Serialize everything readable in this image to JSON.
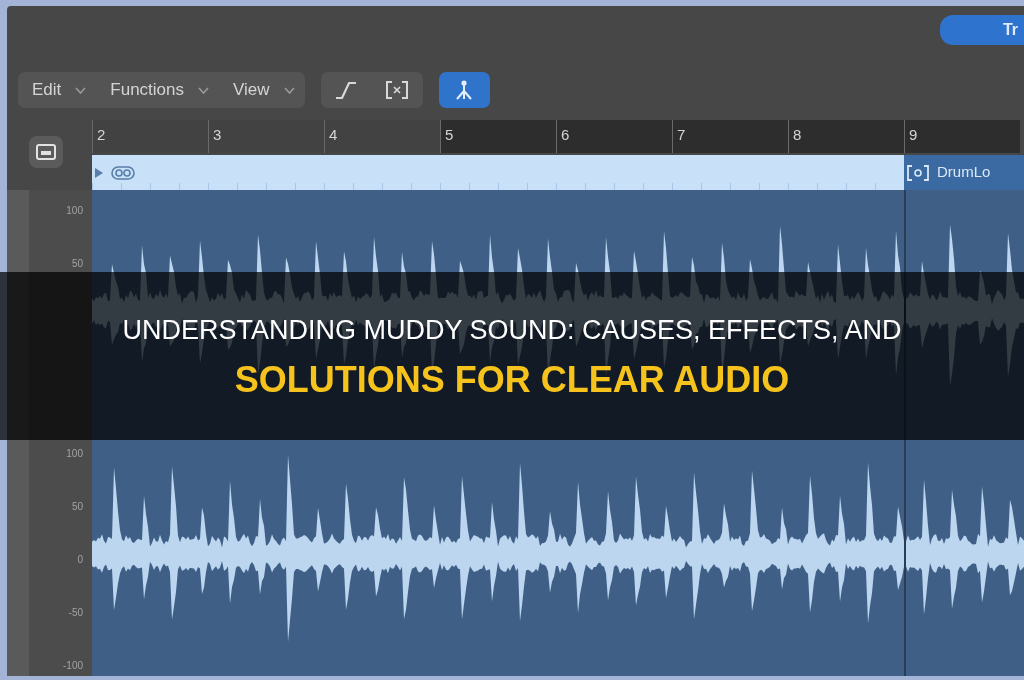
{
  "header": {
    "button": "Tr"
  },
  "toolbar": {
    "menus": [
      {
        "label": "Edit"
      },
      {
        "label": "Functions"
      },
      {
        "label": "View"
      }
    ],
    "tool_groups": [
      {
        "tools": [
          {
            "selected": false
          },
          {
            "selected": false
          }
        ]
      },
      {
        "tools": [
          {
            "selected": true
          }
        ]
      }
    ]
  },
  "ruler": {
    "bars": [
      {
        "label": "2",
        "highlighted": false
      },
      {
        "label": "3",
        "highlighted": false
      },
      {
        "label": "4",
        "highlighted": false
      },
      {
        "label": "5",
        "highlighted": true
      },
      {
        "label": "6",
        "highlighted": true
      },
      {
        "label": "7",
        "highlighted": true
      },
      {
        "label": "8",
        "highlighted": true
      },
      {
        "label": "9",
        "highlighted": true
      }
    ]
  },
  "level_axes": [
    {
      "ticks": [
        "100",
        "50"
      ]
    },
    {
      "ticks": [
        "100",
        "50",
        "0",
        "-50",
        "-100"
      ]
    }
  ],
  "regions": [
    {
      "selected": true
    },
    {
      "name": "DrumLo",
      "selected": false
    }
  ],
  "title": {
    "lines": [
      {
        "text": "UNDERSTANDING MUDDY SOUND: CAUSES, EFFECTS, AND",
        "color": "#ffffff"
      },
      {
        "text": "SOLUTIONS FOR CLEAR AUDIO",
        "color": "#f6c21c"
      }
    ]
  }
}
